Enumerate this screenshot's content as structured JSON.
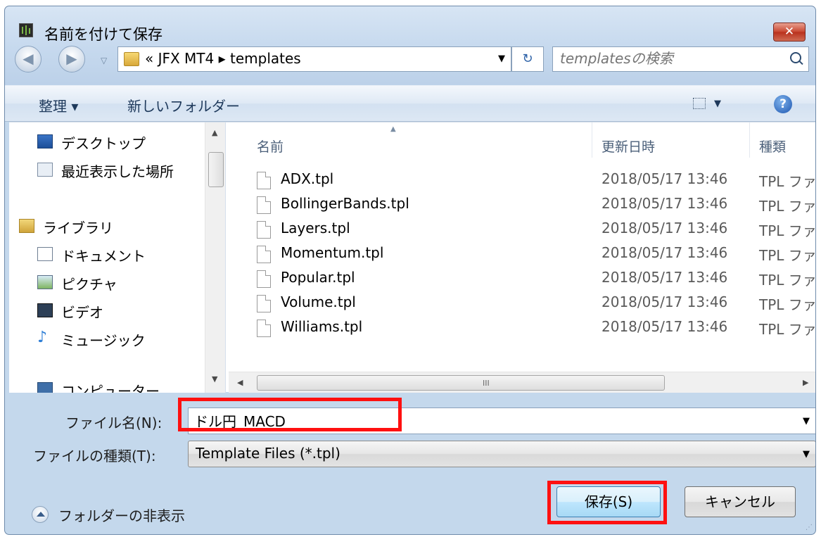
{
  "window": {
    "title": "名前を付けて保存",
    "close_label": "✕"
  },
  "nav": {
    "back_icon": "back-arrow-icon",
    "forward_icon": "forward-arrow-icon",
    "address_prefix": "«",
    "breadcrumb": [
      "JFX MT4",
      "templates"
    ],
    "address_text": "« JFX MT4 ▸ templates",
    "search_placeholder": "templatesの検索"
  },
  "toolbar": {
    "organize": "整理 ▾",
    "new_folder": "新しいフォルダー"
  },
  "sidebar": {
    "items": [
      {
        "label": "デスクトップ",
        "icon": "desktop-icon"
      },
      {
        "label": "最近表示した場所",
        "icon": "recent-places-icon"
      },
      {
        "label": "ライブラリ",
        "icon": "library-icon"
      },
      {
        "label": "ドキュメント",
        "icon": "documents-icon"
      },
      {
        "label": "ピクチャ",
        "icon": "pictures-icon"
      },
      {
        "label": "ビデオ",
        "icon": "video-icon"
      },
      {
        "label": "ミュージック",
        "icon": "music-icon"
      },
      {
        "label": "コンピューター",
        "icon": "computer-icon"
      }
    ]
  },
  "list": {
    "columns": [
      "名前",
      "更新日時",
      "種類"
    ],
    "files": [
      {
        "name": "ADX.tpl",
        "date": "2018/05/17 13:46",
        "type": "TPL ファイル"
      },
      {
        "name": "BollingerBands.tpl",
        "date": "2018/05/17 13:46",
        "type": "TPL ファイル"
      },
      {
        "name": "Layers.tpl",
        "date": "2018/05/17 13:46",
        "type": "TPL ファイル"
      },
      {
        "name": "Momentum.tpl",
        "date": "2018/05/17 13:46",
        "type": "TPL ファイル"
      },
      {
        "name": "Popular.tpl",
        "date": "2018/05/17 13:46",
        "type": "TPL ファイル"
      },
      {
        "name": "Volume.tpl",
        "date": "2018/05/17 13:46",
        "type": "TPL ファイル"
      },
      {
        "name": "Williams.tpl",
        "date": "2018/05/17 13:46",
        "type": "TPL ファイル"
      }
    ]
  },
  "form": {
    "filename_label": "ファイル名(N):",
    "filename_value": "ドル円_MACD",
    "filetype_label": "ファイルの種類(T):",
    "filetype_value": "Template Files (*.tpl)"
  },
  "footer": {
    "hide_folders": "フォルダーの非表示",
    "save_button": "保存(S)",
    "cancel_button": "キャンセル"
  },
  "colors": {
    "highlight": "#ff1010",
    "chrome": "#c6d9ee"
  }
}
